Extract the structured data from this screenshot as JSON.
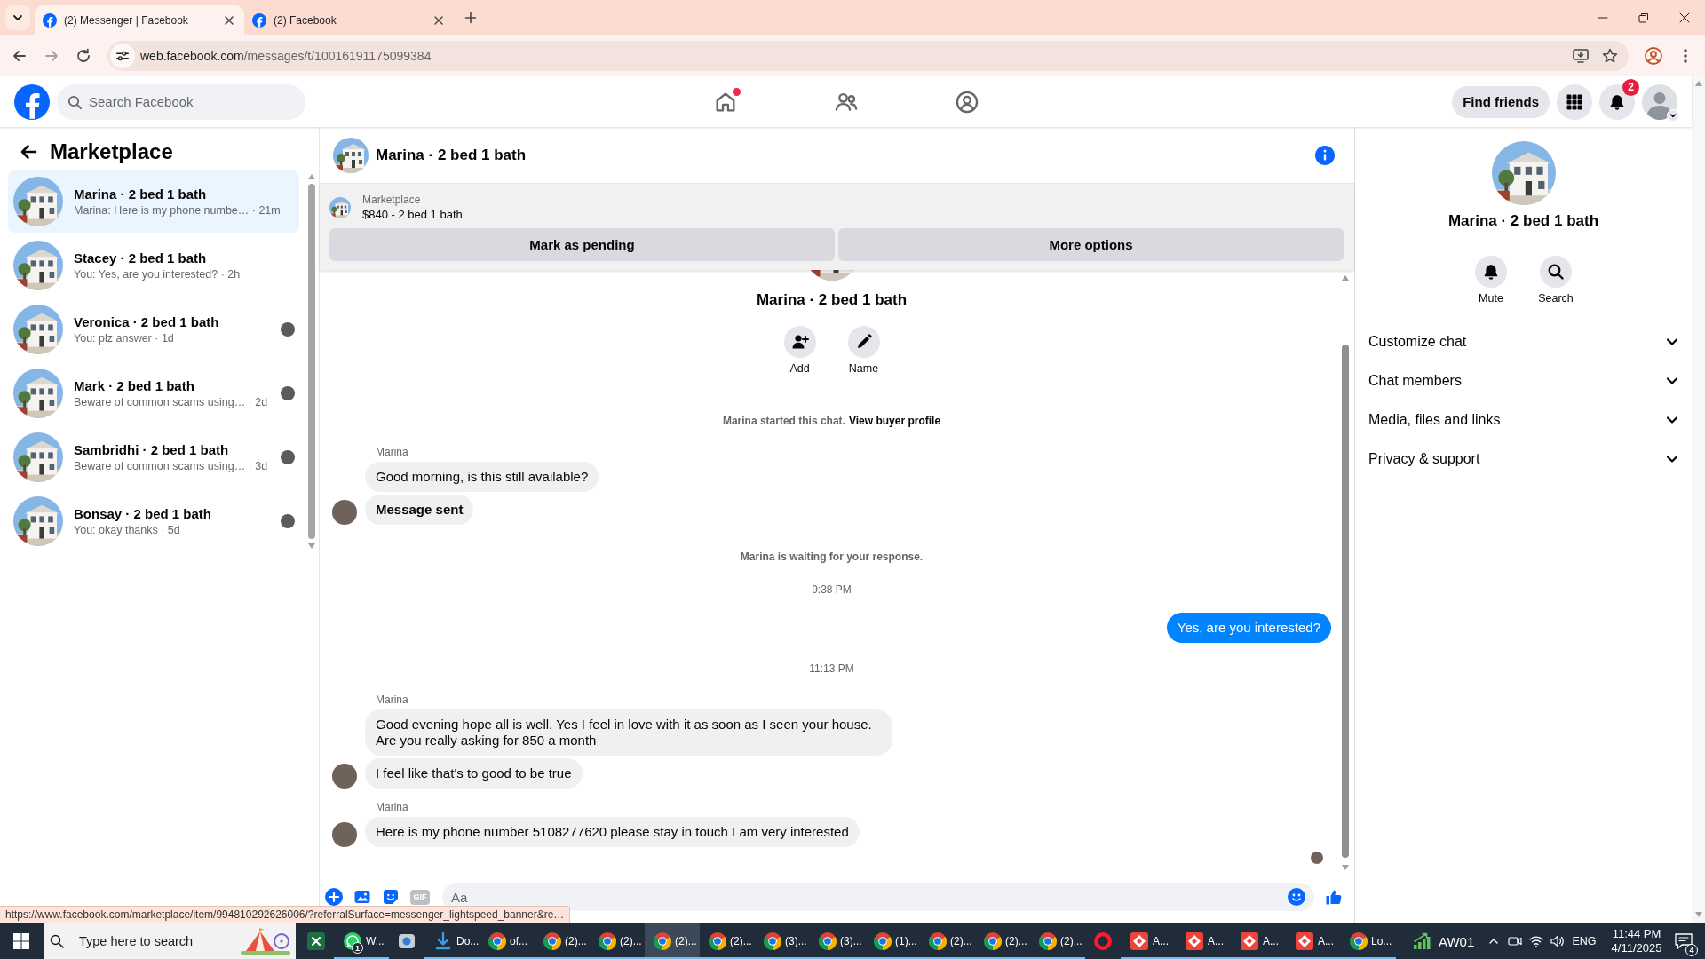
{
  "browser": {
    "tabs": [
      {
        "title": "(2) Messenger | Facebook",
        "selected": true
      },
      {
        "title": "(2) Facebook",
        "selected": false
      }
    ],
    "address": {
      "host": "web.facebook.com",
      "path": "/messages/t/10016191175099384"
    }
  },
  "header": {
    "search": {
      "placeholder": "Search Facebook"
    },
    "nav": [
      {
        "kind": "home",
        "selected": false,
        "dot": true
      },
      {
        "kind": "friends",
        "selected": false,
        "dot": false
      },
      {
        "kind": "profile",
        "selected": false,
        "dot": false
      }
    ],
    "find_friends": "Find friends",
    "notification_count": "2"
  },
  "sidebar": {
    "title": "Marketplace",
    "conversations": [
      {
        "name": "Marina · 2 bed 1 bath",
        "snippet": "Marina: Here is my phone numbe… · 21m",
        "selected": true,
        "seen": false
      },
      {
        "name": "Stacey · 2 bed 1 bath",
        "snippet": "You: Yes, are you interested? · 2h",
        "selected": false,
        "seen": false
      },
      {
        "name": "Veronica · 2 bed 1 bath",
        "snippet": "You: plz answer · 1d",
        "selected": false,
        "seen": true
      },
      {
        "name": "Mark · 2 bed 1 bath",
        "snippet": "Beware of common scams using… · 2d",
        "selected": false,
        "seen": true
      },
      {
        "name": "Sambridhi · 2 bed 1 bath",
        "snippet": "Beware of common scams using… · 3d",
        "selected": false,
        "seen": true
      },
      {
        "name": "Bonsay · 2 bed 1 bath",
        "snippet": "You: okay thanks · 5d",
        "selected": false,
        "seen": true
      }
    ]
  },
  "chat": {
    "title": "Marina · 2 bed 1 bath",
    "listing": {
      "source": "Marketplace",
      "title": "$840 - 2 bed 1 bath",
      "actions": [
        "Mark as pending",
        "More options"
      ]
    },
    "intro": {
      "name": "Marina · 2 bed 1 bath",
      "actions": [
        {
          "kind": "add",
          "label": "Add"
        },
        {
          "kind": "name",
          "label": "Name"
        }
      ]
    },
    "items": [
      {
        "kind": "notice",
        "text": "Marina started this chat.",
        "link": "View buyer profile"
      },
      {
        "kind": "incoming",
        "sender": "Marina",
        "messages": [
          {
            "text": "Good morning, is this still available?",
            "bold": false
          },
          {
            "text": "Message sent",
            "bold": true
          }
        ]
      },
      {
        "kind": "notice",
        "text": "Marina is waiting for your response."
      },
      {
        "kind": "time",
        "text": "9:38 PM"
      },
      {
        "kind": "outgoing",
        "messages": [
          {
            "text": "Yes, are you interested?",
            "bold": false
          }
        ]
      },
      {
        "kind": "time",
        "text": "11:13 PM"
      },
      {
        "kind": "incoming",
        "sender": "Marina",
        "messages": [
          {
            "text": "Good evening hope all is well. Yes I feel in love with it as soon as I seen your house. Are you really asking for 850 a month",
            "bold": false
          },
          {
            "text": "I feel like that's to good to be true",
            "bold": false
          }
        ]
      },
      {
        "kind": "incoming",
        "sender": "Marina",
        "messages": [
          {
            "text": "Here is my phone number 5108277620 please stay in touch I am very interested",
            "bold": false
          }
        ]
      }
    ],
    "seen": true,
    "composer": {
      "gif": "GIF",
      "placeholder": "Aa"
    }
  },
  "details": {
    "name": "Marina · 2 bed 1 bath",
    "actions": [
      {
        "kind": "mute",
        "label": "Mute"
      },
      {
        "kind": "search",
        "label": "Search"
      }
    ],
    "sections": [
      {
        "label": "Customize chat",
        "expanded": false
      },
      {
        "label": "Chat members",
        "expanded": false
      },
      {
        "label": "Media, files and links",
        "expanded": false
      },
      {
        "label": "Privacy & support",
        "expanded": false
      }
    ]
  },
  "status_url": "https://www.facebook.com/marketplace/item/994810292626006/?referralSurface=messenger_lightspeed_banner&re…",
  "taskbar": {
    "search": {
      "placeholder": "Type here to search"
    },
    "apps": [
      {
        "kind": "excel",
        "selected": false,
        "running": false
      },
      {
        "kind": "whatsapp",
        "label": "W...",
        "badge": "1",
        "selected": false,
        "running": true
      },
      {
        "kind": "app",
        "selected": false,
        "running": false
      },
      {
        "kind": "download",
        "label": "Do...",
        "selected": false,
        "running": true
      },
      {
        "kind": "chrome",
        "label": "of...",
        "selected": false,
        "running": true
      },
      {
        "kind": "chrome",
        "label": "(2)...",
        "selected": false,
        "running": true
      },
      {
        "kind": "chrome",
        "label": "(2)...",
        "selected": false,
        "running": true
      },
      {
        "kind": "chrome",
        "label": "(2)...",
        "selected": true,
        "running": true
      },
      {
        "kind": "chrome",
        "label": "(2)...",
        "selected": false,
        "running": true
      },
      {
        "kind": "chrome",
        "label": "(3)...",
        "selected": false,
        "running": true
      },
      {
        "kind": "chrome",
        "label": "(3)...",
        "selected": false,
        "running": true
      },
      {
        "kind": "chrome",
        "label": "(1)...",
        "selected": false,
        "running": true
      },
      {
        "kind": "chrome",
        "label": "(2)...",
        "selected": false,
        "running": true
      },
      {
        "kind": "chrome",
        "label": "(2)...",
        "selected": false,
        "running": true
      },
      {
        "kind": "chrome",
        "label": "(2)...",
        "selected": false,
        "running": true
      },
      {
        "kind": "opera",
        "selected": false,
        "running": false
      },
      {
        "kind": "anydesk",
        "label": "A...",
        "selected": false,
        "running": true
      },
      {
        "kind": "anydesk",
        "label": "A...",
        "selected": false,
        "running": true
      },
      {
        "kind": "anydesk",
        "label": "A...",
        "selected": false,
        "running": true
      },
      {
        "kind": "anydesk",
        "label": "A...",
        "selected": false,
        "running": true
      },
      {
        "kind": "chrome",
        "label": "Lo...",
        "selected": false,
        "running": true
      }
    ],
    "network": "AW01",
    "language": "ENG",
    "time": "11:44 PM",
    "date": "4/11/2025",
    "notifications": "4"
  }
}
